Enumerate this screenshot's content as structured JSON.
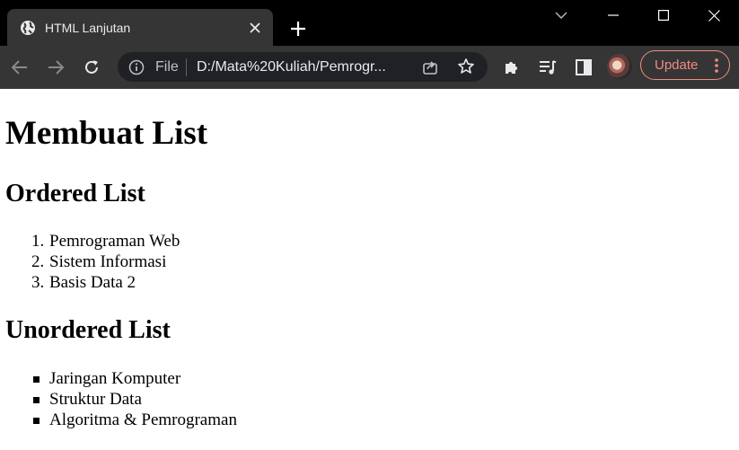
{
  "browser": {
    "tab": {
      "title": "HTML Lanjutan"
    },
    "address_bar": {
      "scheme_label": "File",
      "url": "D:/Mata%20Kuliah/Pemrogr..."
    },
    "update_button": {
      "label": "Update"
    },
    "colors": {
      "titlebar_bg": "#000000",
      "toolbar_bg": "#353535",
      "omnibox_bg": "#202124",
      "text": "#e8eaed",
      "update_accent": "#f28b82"
    }
  },
  "page": {
    "heading": "Membuat List",
    "ordered": {
      "heading": "Ordered List",
      "items": [
        {
          "marker": "1.",
          "text": "Pemrograman Web"
        },
        {
          "marker": "2.",
          "text": "Sistem Informasi"
        },
        {
          "marker": "3.",
          "text": "Basis Data 2"
        }
      ]
    },
    "unordered": {
      "heading": "Unordered List",
      "items": [
        {
          "text": "Jaringan Komputer"
        },
        {
          "text": "Struktur Data"
        },
        {
          "text": "Algoritma & Pemrograman"
        }
      ]
    }
  }
}
